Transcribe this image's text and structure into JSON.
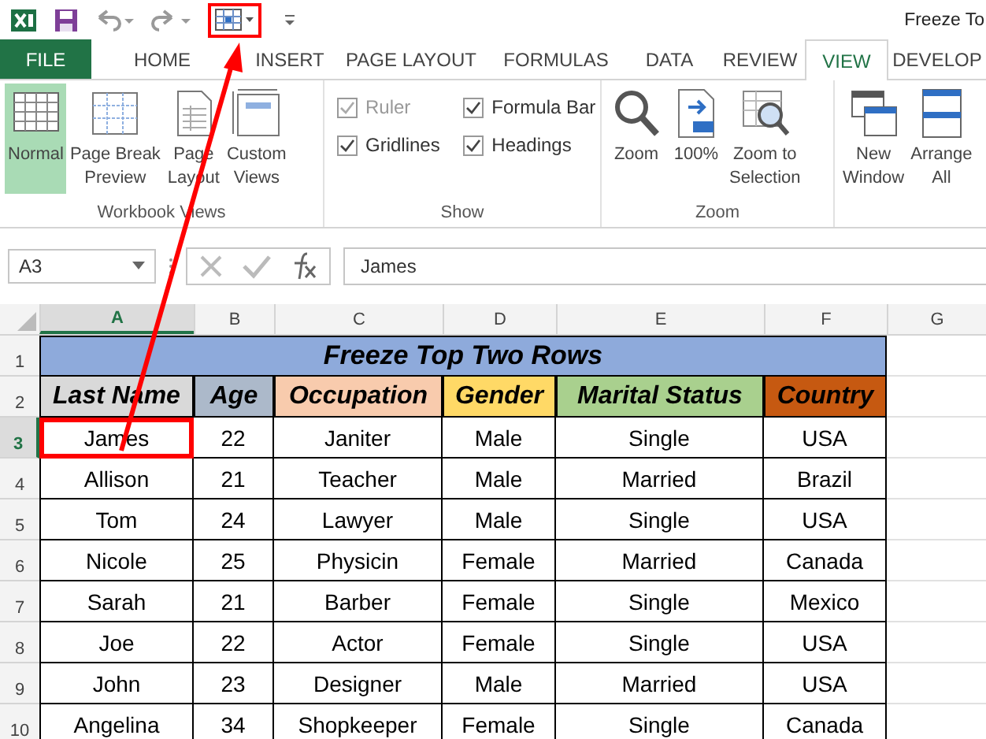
{
  "quick_access": {
    "freeze_panes_highlighted": true
  },
  "window_title": "Freeze To",
  "tabs": [
    {
      "label": "FILE",
      "kind": "file",
      "selected": false
    },
    {
      "label": "HOME",
      "kind": "tab",
      "selected": false
    },
    {
      "label": "INSERT",
      "kind": "tab",
      "selected": false
    },
    {
      "label": "PAGE LAYOUT",
      "kind": "tab",
      "selected": false
    },
    {
      "label": "FORMULAS",
      "kind": "tab",
      "selected": false
    },
    {
      "label": "DATA",
      "kind": "tab",
      "selected": false
    },
    {
      "label": "REVIEW",
      "kind": "tab",
      "selected": false
    },
    {
      "label": "VIEW",
      "kind": "tab",
      "selected": true
    },
    {
      "label": "DEVELOP",
      "kind": "tab",
      "selected": false
    }
  ],
  "ribbon_groups": [
    {
      "label": "Workbook Views",
      "kind": "large",
      "items": [
        {
          "label": "Normal",
          "selected": true
        },
        {
          "label": "Page Break\nPreview",
          "selected": false
        },
        {
          "label": "Page\nLayout",
          "selected": false
        },
        {
          "label": "Custom\nViews",
          "selected": false
        }
      ]
    },
    {
      "label": "Show",
      "kind": "checks",
      "items": [
        {
          "label": "Ruler",
          "checked": true,
          "disabled": true
        },
        {
          "label": "Formula Bar",
          "checked": true,
          "disabled": false
        },
        {
          "label": "Gridlines",
          "checked": true,
          "disabled": false
        },
        {
          "label": "Headings",
          "checked": true,
          "disabled": false
        }
      ]
    },
    {
      "label": "Zoom",
      "kind": "large",
      "items": [
        {
          "label": "Zoom",
          "selected": false
        },
        {
          "label": "100%",
          "selected": false
        },
        {
          "label": "Zoom to\nSelection",
          "selected": false
        }
      ]
    },
    {
      "kind": "large",
      "items": [
        {
          "label": "New\nWindow",
          "selected": false
        },
        {
          "label": "Arrange\nAll",
          "selected": false
        }
      ]
    }
  ],
  "formula_bar": {
    "name_box": "A3",
    "value": "James"
  },
  "sheet": {
    "columns": [
      {
        "label": "A",
        "selected": true
      },
      {
        "label": "B",
        "selected": false
      },
      {
        "label": "C",
        "selected": false
      },
      {
        "label": "D",
        "selected": false
      },
      {
        "label": "E",
        "selected": false
      },
      {
        "label": "F",
        "selected": false
      },
      {
        "label": "G",
        "selected": false
      }
    ],
    "title_row": {
      "number": "1",
      "text": "Freeze Top Two Rows",
      "color": "#8eaadb"
    },
    "header_row": {
      "number": "2",
      "headers": [
        {
          "text": "Last Name",
          "color": "#d9d9d9"
        },
        {
          "text": "Age",
          "color": "#acb9ca"
        },
        {
          "text": "Occupation",
          "color": "#f8cbad"
        },
        {
          "text": "Gender",
          "color": "#ffd966"
        },
        {
          "text": "Marital Status",
          "color": "#a9d08e"
        },
        {
          "text": "Country",
          "color": "#c65911"
        }
      ]
    },
    "rows": [
      {
        "number": "3",
        "selected": true,
        "cells": [
          "James",
          "22",
          "Janiter",
          "Male",
          "Single",
          "USA"
        ]
      },
      {
        "number": "4",
        "selected": false,
        "cells": [
          "Allison",
          "21",
          "Teacher",
          "Male",
          "Married",
          "Brazil"
        ]
      },
      {
        "number": "5",
        "selected": false,
        "cells": [
          "Tom",
          "24",
          "Lawyer",
          "Male",
          "Single",
          "USA"
        ]
      },
      {
        "number": "6",
        "selected": false,
        "cells": [
          "Nicole",
          "25",
          "Physicin",
          "Female",
          "Married",
          "Canada"
        ]
      },
      {
        "number": "7",
        "selected": false,
        "cells": [
          "Sarah",
          "21",
          "Barber",
          "Female",
          "Single",
          "Mexico"
        ]
      },
      {
        "number": "8",
        "selected": false,
        "cells": [
          "Joe",
          "22",
          "Actor",
          "Female",
          "Single",
          "USA"
        ]
      },
      {
        "number": "9",
        "selected": false,
        "cells": [
          "John",
          "23",
          "Designer",
          "Male",
          "Married",
          "USA"
        ]
      },
      {
        "number": "10",
        "selected": false,
        "cells": [
          "Angelina",
          "34",
          "Shopkeeper",
          "Female",
          "Single",
          "Canada"
        ]
      }
    ]
  }
}
